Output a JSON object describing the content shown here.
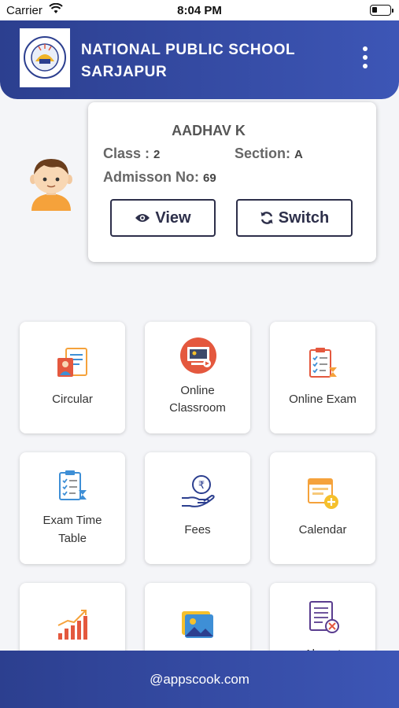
{
  "status_bar": {
    "carrier": "Carrier",
    "time": "8:04 PM"
  },
  "header": {
    "line1": "NATIONAL PUBLIC SCHOOL",
    "line2": "SARJAPUR"
  },
  "student": {
    "name": "AADHAV K",
    "class_label": "Class :",
    "class_value": "2",
    "section_label": "Section:",
    "section_value": "A",
    "admission_label": "Admisson No:",
    "admission_value": "69"
  },
  "buttons": {
    "view": "View",
    "switch": "Switch"
  },
  "tiles": [
    {
      "line1": "Circular",
      "line2": ""
    },
    {
      "line1": "Online",
      "line2": "Classroom"
    },
    {
      "line1": "Online Exam",
      "line2": ""
    },
    {
      "line1": "Exam Time",
      "line2": "Table"
    },
    {
      "line1": "Fees",
      "line2": ""
    },
    {
      "line1": "Calendar",
      "line2": ""
    },
    {
      "line1": "",
      "line2": ""
    },
    {
      "line1": "",
      "line2": ""
    },
    {
      "line1": "Absent",
      "line2": ""
    }
  ],
  "footer": {
    "text": "@appscook.com"
  },
  "colors": {
    "header": "#3249a3",
    "accent_red": "#e4583e",
    "accent_blue": "#3e8fd6",
    "accent_yellow": "#f5c02c"
  }
}
